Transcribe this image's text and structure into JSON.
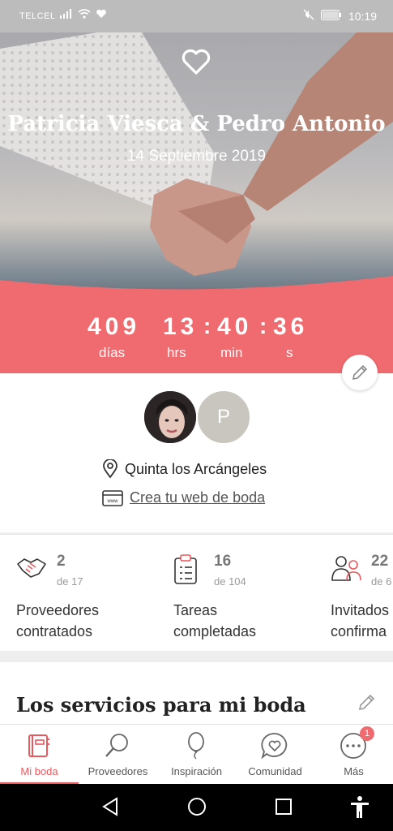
{
  "status": {
    "carrier": "TELCEL",
    "time": "10:19",
    "battery": "98"
  },
  "hero": {
    "couple": "Patricia Viesca & Pedro Antonio",
    "date": "14 Septiembre 2019",
    "countdown": [
      {
        "value": "409",
        "label": "días"
      },
      {
        "value": "13",
        "label": "hrs"
      },
      {
        "value": "40",
        "label": "min"
      },
      {
        "value": "36",
        "label": "s"
      }
    ],
    "accent": "#f06b6f"
  },
  "profile": {
    "partner_initial": "P",
    "venue": "Quinta los Arcángeles",
    "web_link": "Crea tu web de boda"
  },
  "stats": [
    {
      "icon": "handshake-icon",
      "num": "2",
      "of": "de 17",
      "label1": "Proveedores",
      "label2": "contratados"
    },
    {
      "icon": "clipboard-list-icon",
      "num": "16",
      "of": "de 104",
      "label1": "Tareas",
      "label2": "completadas"
    },
    {
      "icon": "guests-icon",
      "num": "22",
      "of": "de 6",
      "label1": "Invitados",
      "label2": "confirma"
    }
  ],
  "services": {
    "title": "Los servicios para mi boda"
  },
  "nav": {
    "items": [
      {
        "label": "Mi boda",
        "icon": "notebook-icon"
      },
      {
        "label": "Proveedores",
        "icon": "search-icon"
      },
      {
        "label": "Inspiración",
        "icon": "balloon-icon"
      },
      {
        "label": "Comunidad",
        "icon": "chat-heart-icon"
      },
      {
        "label": "Más",
        "icon": "more-icon",
        "badge": "1"
      }
    ]
  }
}
